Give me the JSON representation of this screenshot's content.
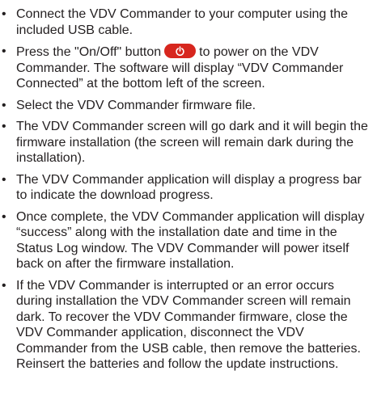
{
  "bullets": [
    {
      "text": "Connect the VDV Commander to your computer using the included USB cable."
    },
    {
      "before": "Press the \"On/Off\" button",
      "icon": "power-icon",
      "after": "to power on the VDV Commander. The software will display “VDV Commander Connected” at the bottom left of the screen."
    },
    {
      "text": "Select the VDV Commander firmware file."
    },
    {
      "text": "The VDV Commander screen will go dark and it will begin the firmware installation (the screen will remain dark during the installation)."
    },
    {
      "text": "The VDV Commander application will display a progress bar to indicate the download progress."
    },
    {
      "text": "Once complete, the VDV Commander application will display “success” along with the installation date and time in the Status Log window. The VDV Commander will power itself back on after the firmware installation."
    },
    {
      "text": "If the VDV Commander is interrupted or an error occurs during installation the VDV Commander screen will remain dark. To recover the VDV Commander firmware, close the VDV Commander application, disconnect the VDV Commander from the USB cable, then remove the batteries. Reinsert the batteries and follow the update instructions."
    }
  ],
  "colors": {
    "text": "#231f20",
    "power_button": "#d7261e"
  }
}
